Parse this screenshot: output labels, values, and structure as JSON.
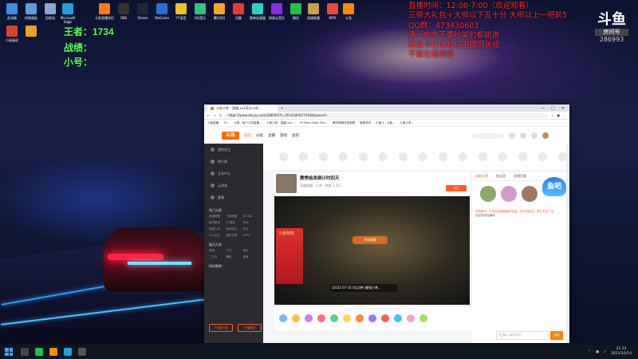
{
  "desktop_icons": [
    {
      "label": "此电脑",
      "color": "#3a8ee6"
    },
    {
      "label": "控制面板",
      "color": "#5a9fd6"
    },
    {
      "label": "回收站",
      "color": "#88aacc"
    },
    {
      "label": "Microsoft Edge",
      "color": "#1fa1e0"
    },
    {
      "label": "斗鱼直播伴侣",
      "color": "#ff7a1a"
    },
    {
      "label": "OBS",
      "color": "#333333"
    },
    {
      "label": "Steam",
      "color": "#1b2838"
    },
    {
      "label": "WeGame",
      "color": "#2670d9"
    },
    {
      "label": "YY语音",
      "color": "#f0c020"
    },
    {
      "label": "QQ音乐",
      "color": "#31c27c"
    },
    {
      "label": "腾讯QQ",
      "color": "#f5a623"
    },
    {
      "label": "迅雷",
      "color": "#e93a3a"
    },
    {
      "label": "雷神加速器",
      "color": "#30d0c0"
    },
    {
      "label": "网易云音乐",
      "color": "#8a2be2"
    },
    {
      "label": "微信",
      "color": "#22c14a"
    },
    {
      "label": "英雄联盟",
      "color": "#c9a14a"
    },
    {
      "label": "WPS",
      "color": "#e84a3a"
    },
    {
      "label": "斗鱼",
      "color": "#ff8a00"
    },
    {
      "label": "小说阅读",
      "color": "#d6452f"
    }
  ],
  "stats": {
    "king": "王者：1734",
    "record": "战绩：",
    "alt": "小号："
  },
  "announcement": [
    "直播时间：12:00-7:00（欢迎观看）",
    "三带大礼包＋大师以下五十分 大师以上一把前5",
    "QQ群：473430603",
    "满一血的不要吵架的都能进",
    "粉丝卡打ID私信主播回关组",
    "不能在线调控"
  ],
  "room_logo": {
    "brand": "斗鱼",
    "label": "房间号",
    "number": "286993"
  },
  "browser": {
    "tab_title": "斗鱼小茶 - 直播_LoL官方斗鱼...",
    "url": "https://www.douyu.com/286993?t=1634180627#284&search",
    "bookmarks": [
      "斗鱼直播",
      "TV...",
      "斗鱼 - 每个人的直播...",
      "斗鱼小茶 - 直播_LoL...",
      "YY Meta Data Tren...",
      "腾讯视频在线观看",
      "新闻资讯",
      "小鱼儿 - 斗鱼...",
      "斗鱼小茶..."
    ],
    "nav": [
      "首页",
      "分类",
      "直播",
      "游戏",
      "鱼吧"
    ],
    "site_logo": "斗鱼",
    "sidebar": {
      "items": [
        "我的关注",
        "排行榜",
        "互动中心",
        "云游戏",
        "赛事"
      ],
      "section1": "热门分类",
      "grid1": [
        "英雄联盟",
        "王者荣耀",
        "DOTA2",
        "和平精英",
        "CF端游",
        "DNF",
        "穿越火线",
        "绝地求生",
        "炉石",
        "LOL云顶",
        "我的世界",
        "APEX"
      ],
      "section2": "娱乐天地",
      "grid2": [
        "颜值",
        "户外",
        "音乐",
        "二次元",
        "舞蹈",
        "美食"
      ],
      "section3": "科技教育",
      "buttons": [
        "下载客户端",
        "开播教程"
      ]
    },
    "room": {
      "title": "赛季结束倒计时四天",
      "meta": "英雄联盟 · 小茶 · 热度 1.3万",
      "follow": "关注",
      "play": "开始观看",
      "overlay": "[2021-07-16 01点钟] 最强小茶...",
      "banner": "斗鱼特权"
    },
    "right": {
      "tabs": [
        "贡献日榜",
        "粉丝团",
        "直播回看"
      ],
      "chat": [
        "系统提示：已经开启弹幕保护功能，请文明发言，禁止发布广告。",
        "欢迎来到直播间"
      ],
      "input_placeholder": "这里输入聊天内容",
      "send": "发送"
    },
    "float_badge": "鱼吧"
  },
  "taskbar": {
    "time": "21:32",
    "date": "2021/10/14"
  }
}
